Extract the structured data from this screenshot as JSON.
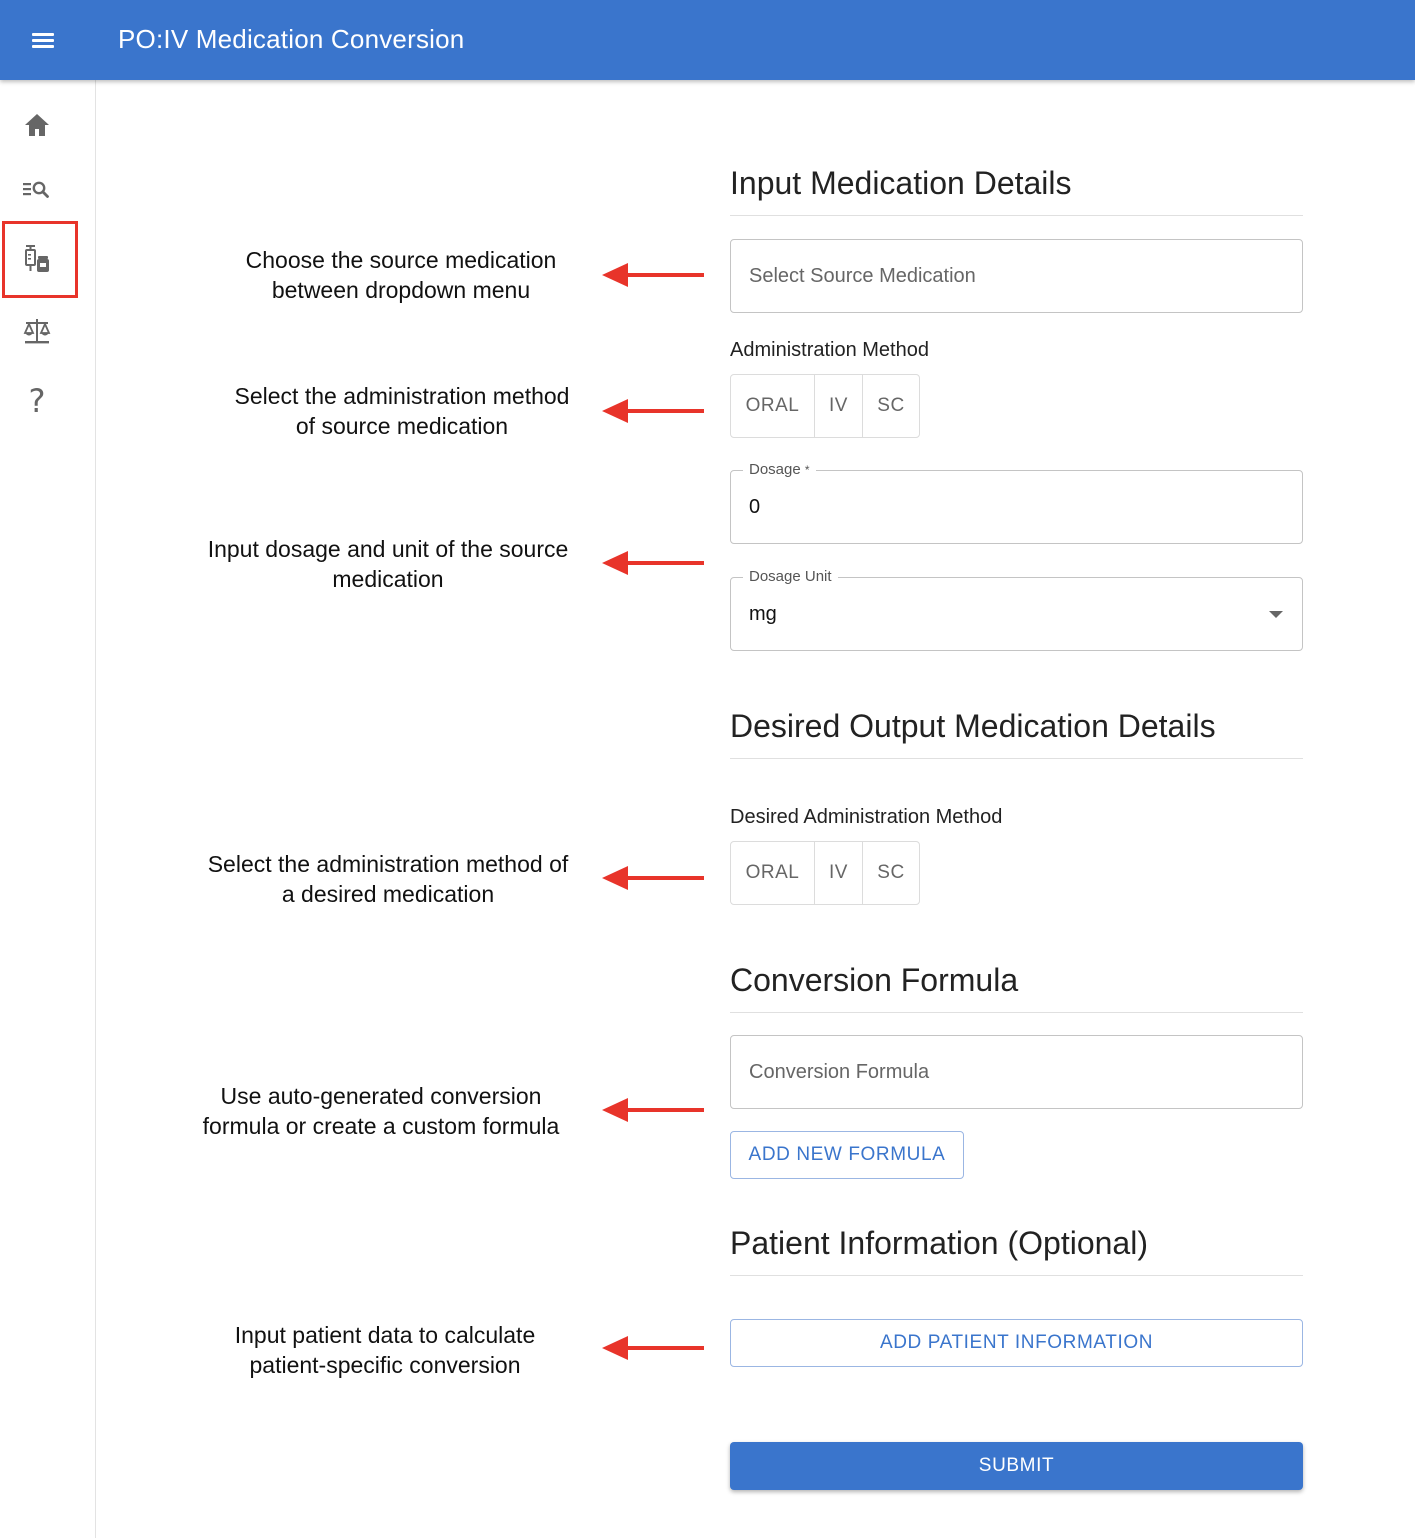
{
  "app": {
    "title": "PO:IV Medication Conversion"
  },
  "sidebar": {
    "items": [
      {
        "icon": "home-icon"
      },
      {
        "icon": "search-list-icon"
      },
      {
        "icon": "medication-icon",
        "highlighted": true
      },
      {
        "icon": "scale-icon"
      },
      {
        "icon": "help-icon",
        "glyph": "?"
      }
    ]
  },
  "annotations": [
    {
      "line1": "Choose the source medication",
      "line2": "between dropdown menu"
    },
    {
      "line1": "Select the administration method",
      "line2": "of source medication"
    },
    {
      "line1": "Input dosage and unit of the source",
      "line2": "medication"
    },
    {
      "line1": "Select the administration method of",
      "line2": "a desired medication"
    },
    {
      "line1": "Use auto-generated conversion",
      "line2": "formula or create a custom formula"
    },
    {
      "line1": "Input patient data to calculate",
      "line2": "patient-specific conversion"
    }
  ],
  "input_section": {
    "title": "Input Medication Details",
    "source_placeholder": "Select Source Medication",
    "admin_label": "Administration Method",
    "admin_options": [
      "ORAL",
      "IV",
      "SC"
    ],
    "dosage_label": "Dosage",
    "dosage_required_mark": "*",
    "dosage_value": "0",
    "unit_label": "Dosage Unit",
    "unit_value": "mg"
  },
  "output_section": {
    "title": "Desired Output Medication Details",
    "admin_label": "Desired Administration Method",
    "admin_options": [
      "ORAL",
      "IV",
      "SC"
    ]
  },
  "formula_section": {
    "title": "Conversion Formula",
    "placeholder": "Conversion Formula",
    "add_button": "ADD NEW FORMULA"
  },
  "patient_section": {
    "title": "Patient Information (Optional)",
    "add_button": "ADD PATIENT INFORMATION"
  },
  "submit_label": "SUBMIT",
  "colors": {
    "primary": "#3a75cc",
    "annotation_arrow": "#e8342a",
    "highlight_box": "#e8342a"
  }
}
